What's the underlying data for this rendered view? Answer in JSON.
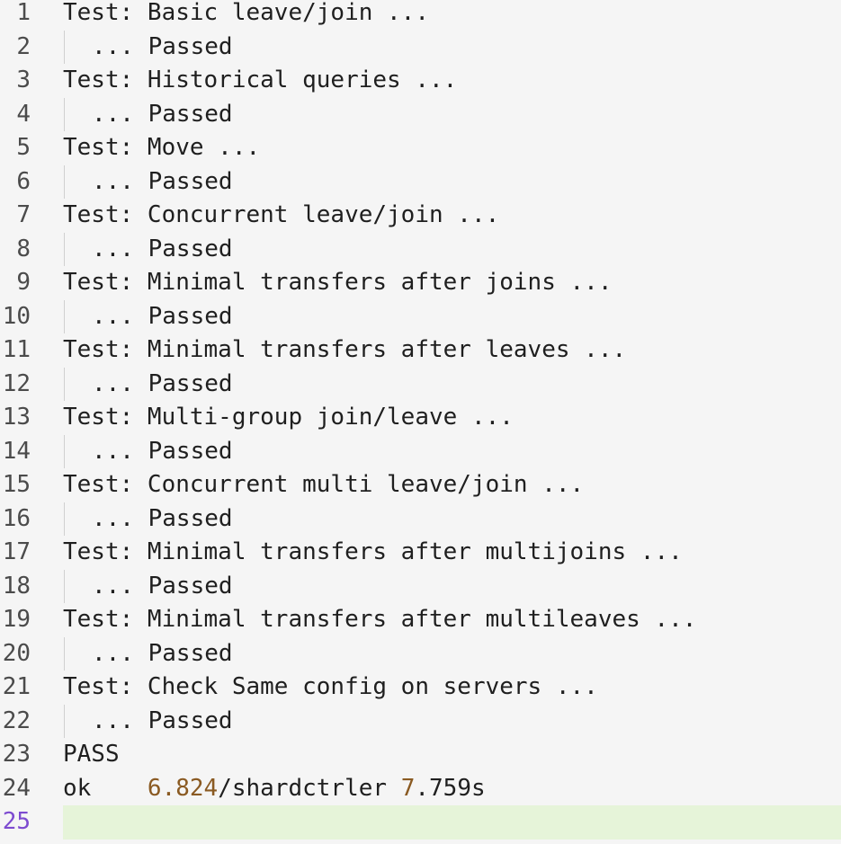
{
  "lines": [
    {
      "n": "1",
      "text": "Test: Basic leave/join ...",
      "indent": false
    },
    {
      "n": "2",
      "text": "... Passed",
      "indent": true
    },
    {
      "n": "3",
      "text": "Test: Historical queries ...",
      "indent": false
    },
    {
      "n": "4",
      "text": "... Passed",
      "indent": true
    },
    {
      "n": "5",
      "text": "Test: Move ...",
      "indent": false
    },
    {
      "n": "6",
      "text": "... Passed",
      "indent": true
    },
    {
      "n": "7",
      "text": "Test: Concurrent leave/join ...",
      "indent": false
    },
    {
      "n": "8",
      "text": "... Passed",
      "indent": true
    },
    {
      "n": "9",
      "text": "Test: Minimal transfers after joins ...",
      "indent": false
    },
    {
      "n": "10",
      "text": "... Passed",
      "indent": true
    },
    {
      "n": "11",
      "text": "Test: Minimal transfers after leaves ...",
      "indent": false
    },
    {
      "n": "12",
      "text": "... Passed",
      "indent": true
    },
    {
      "n": "13",
      "text": "Test: Multi-group join/leave ...",
      "indent": false
    },
    {
      "n": "14",
      "text": "... Passed",
      "indent": true
    },
    {
      "n": "15",
      "text": "Test: Concurrent multi leave/join ...",
      "indent": false
    },
    {
      "n": "16",
      "text": "... Passed",
      "indent": true
    },
    {
      "n": "17",
      "text": "Test: Minimal transfers after multijoins ...",
      "indent": false
    },
    {
      "n": "18",
      "text": "... Passed",
      "indent": true
    },
    {
      "n": "19",
      "text": "Test: Minimal transfers after multileaves ...",
      "indent": false
    },
    {
      "n": "20",
      "text": "... Passed",
      "indent": true
    },
    {
      "n": "21",
      "text": "Test: Check Same config on servers ...",
      "indent": false
    },
    {
      "n": "22",
      "text": "... Passed",
      "indent": true
    },
    {
      "n": "23",
      "text": "PASS",
      "indent": false
    },
    {
      "n": "24",
      "segments": [
        {
          "text": "ok    ",
          "cls": ""
        },
        {
          "text": "6",
          "cls": "num"
        },
        {
          "text": ".824",
          "cls": "num"
        },
        {
          "text": "/shardctrler ",
          "cls": ""
        },
        {
          "text": "7",
          "cls": "num"
        },
        {
          "text": ".759s",
          "cls": ""
        }
      ],
      "indent": false
    },
    {
      "n": "25",
      "text": "",
      "indent": false,
      "current": true
    }
  ],
  "colors": {
    "background": "#f5f5f5",
    "text": "#1f1f1f",
    "line_number": "#4b4b4b",
    "current_line_number": "#7d4bd0",
    "current_line_highlight": "#e6f4d9",
    "number_token": "#8a5a22"
  }
}
